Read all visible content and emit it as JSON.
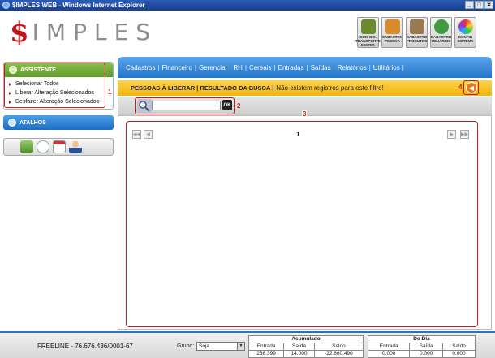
{
  "window": {
    "title": "$IMPLES WEB - Windows Internet Explorer"
  },
  "logo": {
    "dollar": "$",
    "word": "IMPLES"
  },
  "toolbar": {
    "buttons": [
      {
        "label": "CONHEC.\nTRANSPORTE\nESCRIT.",
        "icon": "truck-icon",
        "color": "#6a8c2c"
      },
      {
        "label": "CADASTRO\nPESSOA",
        "icon": "people-icon",
        "color": "#d98a2b"
      },
      {
        "label": "CADASTRO\nPRODUTOS",
        "icon": "boxes-icon",
        "color": "#9a7a50"
      },
      {
        "label": "CADASTRO\nUSUÁRIOS",
        "icon": "user-icon",
        "color": "#3f9a3f"
      },
      {
        "label": "CONFIG\nSISTEMA",
        "icon": "palette-icon",
        "color": "#b03a8a"
      }
    ]
  },
  "sidebar": {
    "assistente": {
      "title": "ASSISTENTE",
      "items": [
        "Selecionar Todos",
        "Liberar Alteração Selecionados",
        "Desfazer Alteração Selecionados"
      ]
    },
    "atalhos": {
      "title": "ATALHOS"
    },
    "quick_icons": [
      "calculator-icon",
      "chat-icon",
      "calendar-icon",
      "user-icon"
    ]
  },
  "nav": {
    "items": [
      "Cadastros",
      "Financeiro",
      "Gerencial",
      "RH",
      "Cereais",
      "Entradas",
      "Saídas",
      "Relatórios",
      "Utilitários"
    ]
  },
  "filter": {
    "heading": "PESSOAS À LIBERAR | RESULTADO DA BUSCA |",
    "message": "Não existem registros para este filtro!"
  },
  "search": {
    "value": "",
    "ok_label": "OK"
  },
  "results": {
    "page": "1"
  },
  "annotations": {
    "n1": "1",
    "n2": "2",
    "n3": "3",
    "n4": "4"
  },
  "footer": {
    "freeline": "FREELINE  -  76.676.436/0001-67",
    "grupo_label": "Grupo:",
    "grupo_value": "Soja",
    "acumulado": {
      "title": "Acumulado",
      "headers": [
        "Entrada",
        "Saída",
        "Saldo"
      ],
      "values": [
        "236.399",
        "14.000",
        "-22.860.490"
      ]
    },
    "do_dia": {
      "title": "Do Dia",
      "headers": [
        "Entrada",
        "Saída",
        "Saldo"
      ],
      "values": [
        "0.000",
        "0.000",
        "0.000"
      ]
    }
  }
}
